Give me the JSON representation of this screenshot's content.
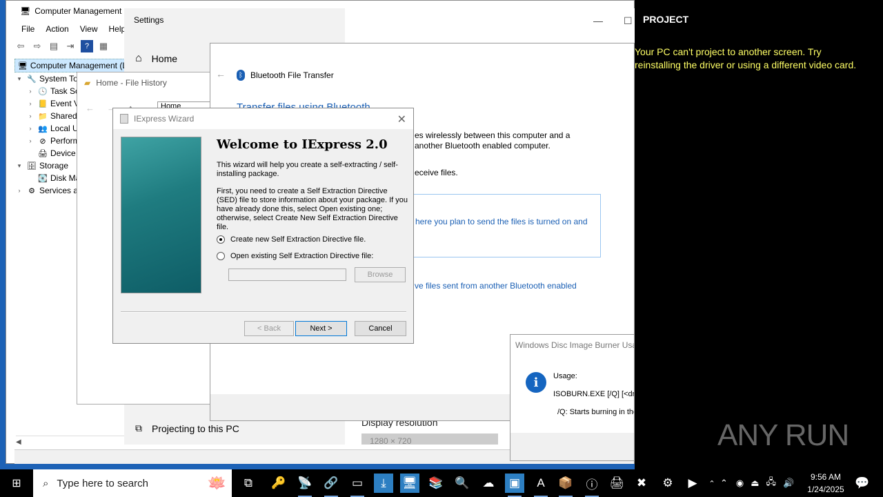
{
  "computer_management": {
    "title": "Computer Management",
    "menu": [
      "File",
      "Action",
      "View",
      "Help"
    ],
    "tree": [
      {
        "label": "Computer Management (Local)",
        "level": 0,
        "expander": "",
        "icon": "computer-management-icon"
      },
      {
        "label": "System Tools",
        "level": 1,
        "expander": "▾",
        "icon": "system-tools-icon"
      },
      {
        "label": "Task Scheduler",
        "level": 2,
        "expander": "›",
        "icon": "task-scheduler-icon"
      },
      {
        "label": "Event Viewer",
        "level": 2,
        "expander": "›",
        "icon": "event-viewer-icon"
      },
      {
        "label": "Shared Folders",
        "level": 2,
        "expander": "›",
        "icon": "shared-folders-icon"
      },
      {
        "label": "Local Users and Groups",
        "level": 2,
        "expander": "›",
        "icon": "local-users-icon"
      },
      {
        "label": "Performance",
        "level": 2,
        "expander": "›",
        "icon": "performance-icon"
      },
      {
        "label": "Device Manager",
        "level": 2,
        "expander": "",
        "icon": "device-manager-icon"
      },
      {
        "label": "Storage",
        "level": 1,
        "expander": "▾",
        "icon": "storage-icon"
      },
      {
        "label": "Disk Management",
        "level": 2,
        "expander": "",
        "icon": "disk-management-icon"
      },
      {
        "label": "Services and Applications",
        "level": 1,
        "expander": "›",
        "icon": "services-icon"
      }
    ]
  },
  "settings": {
    "title": "Settings",
    "home": "Home",
    "projecting": "Projecting to this PC",
    "display_resolution": "Display resolution",
    "resolution_value": "1280 × 720"
  },
  "file_history": {
    "title": "Home - File History",
    "address": "Home"
  },
  "bluetooth": {
    "title": "Bluetooth File Transfer",
    "heading": "Transfer files using Bluetooth",
    "desc_1": "es wirelessly between this computer and a",
    "desc_2": "another Bluetooth enabled computer.",
    "receive": "eceive files.",
    "send_option": "here you plan to send the files is turned on and",
    "receive_option": "ve files sent from another Bluetooth enabled"
  },
  "iexpress": {
    "title": "IExpress Wizard",
    "heading": "Welcome to IExpress 2.0",
    "para1": "This wizard will help you create a self-extracting / self-installing package.",
    "para2": "First, you need to create a Self Extraction Directive (SED) file to store information about your package.  If you have already done this, select Open existing one; otherwise, select Create New Self Extraction Directive file.",
    "option_create": "Create new Self Extraction Directive file.",
    "option_open": "Open existing Self Extraction Directive file:",
    "selected_option": "create",
    "browse": "Browse",
    "back": "< Back",
    "next": "Next >",
    "cancel": "Cancel"
  },
  "iso_burner": {
    "title": "Windows Disc Image Burner Usage",
    "usage": "Usage:",
    "line1": "ISOBURN.EXE [/Q] [<drive>] <disc image>",
    "line2": "/Q: Starts burning in the"
  },
  "project_panel": {
    "header": "PROJECT",
    "message": "Your PC can't project to another screen. Try reinstalling the driver or using a different video card.",
    "watermark": "ANY RUN"
  },
  "taskbar": {
    "search_placeholder": "Type here to search",
    "time": "9:56 AM",
    "date": "1/24/2025"
  },
  "colors": {
    "desktop": "#1d62b6",
    "link_blue": "#1a5fb4",
    "project_message": "#ffff66"
  }
}
